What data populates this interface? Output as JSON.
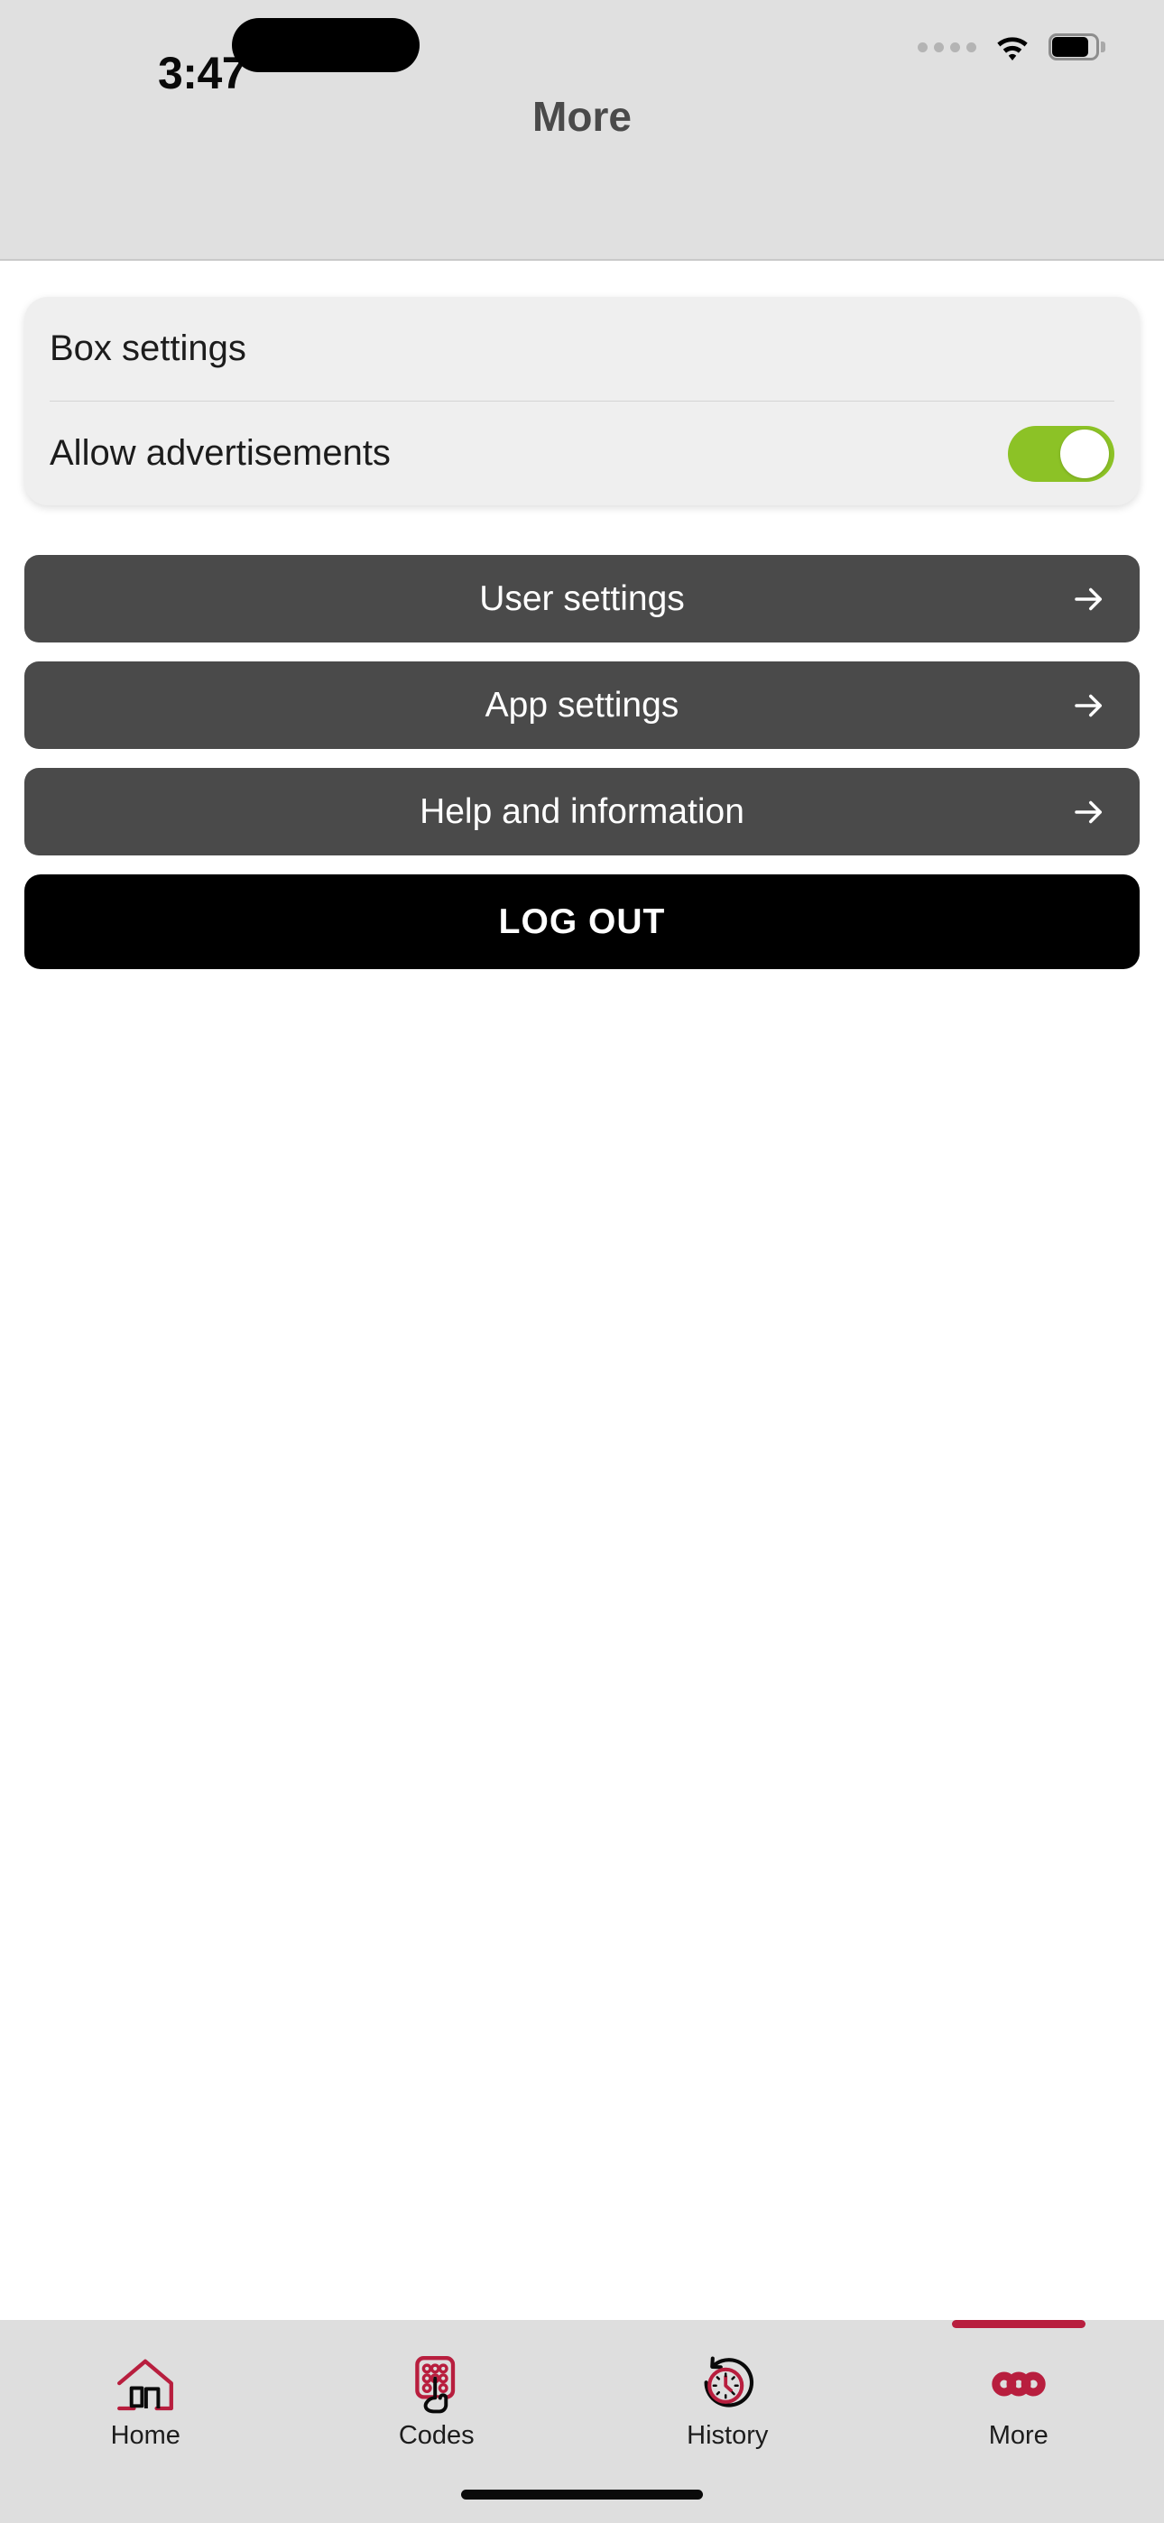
{
  "status_bar": {
    "time": "3:47",
    "cellular_icon": "cellular-dots-icon",
    "wifi_icon": "wifi-icon",
    "battery_icon": "battery-icon"
  },
  "header": {
    "title": "More"
  },
  "settings_card": {
    "rows": [
      {
        "label": "Box settings",
        "type": "link"
      },
      {
        "label": "Allow advertisements",
        "type": "toggle",
        "value": "on"
      }
    ]
  },
  "nav_buttons": [
    {
      "label": "User settings",
      "arrow": "arrow-right-icon"
    },
    {
      "label": "App settings",
      "arrow": "arrow-right-icon"
    },
    {
      "label": "Help and information",
      "arrow": "arrow-right-icon"
    }
  ],
  "logout": {
    "label": "LOG OUT"
  },
  "tabbar": {
    "active": "More",
    "items": [
      {
        "label": "Home",
        "icon": "home-icon"
      },
      {
        "label": "Codes",
        "icon": "keypad-tap-icon"
      },
      {
        "label": "History",
        "icon": "clock-rotate-left-icon"
      },
      {
        "label": "More",
        "icon": "ellipsis-icon"
      }
    ]
  },
  "colors": {
    "accent": "#B81E3E",
    "toggle_on": "#8CC226",
    "button_dark": "#4A4A4A",
    "logout": "#000000",
    "card_bg": "#EFEFEF",
    "chrome_bg": "#E0E0E0"
  }
}
